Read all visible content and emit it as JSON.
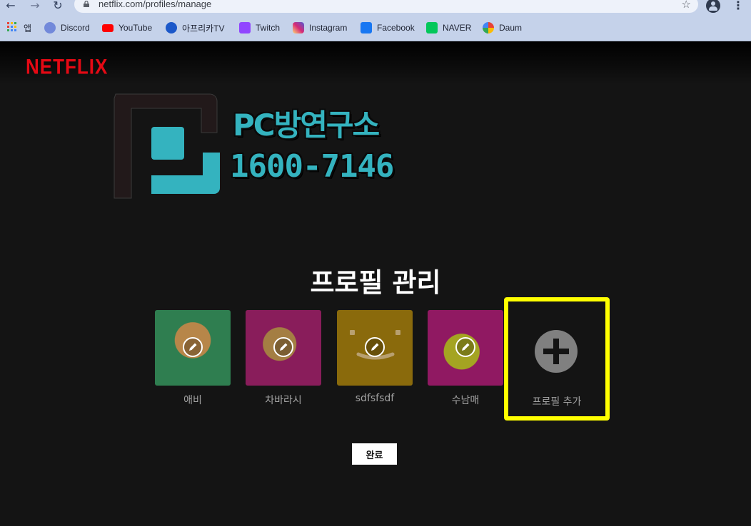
{
  "browser": {
    "url": "netflix.com/profiles/manage",
    "bookmarks": [
      {
        "label": "앱",
        "icon": "apps-grid-icon"
      },
      {
        "label": "Discord",
        "icon": "discord-icon"
      },
      {
        "label": "YouTube",
        "icon": "youtube-icon"
      },
      {
        "label": "아프리카TV",
        "icon": "afreecatv-icon"
      },
      {
        "label": "Twitch",
        "icon": "twitch-icon"
      },
      {
        "label": "Instagram",
        "icon": "instagram-icon"
      },
      {
        "label": "Facebook",
        "icon": "facebook-icon"
      },
      {
        "label": "NAVER",
        "icon": "naver-icon"
      },
      {
        "label": "Daum",
        "icon": "daum-icon"
      }
    ]
  },
  "brand": {
    "logo_text": "NETFLIX",
    "color": "#e50914"
  },
  "overlay_ad": {
    "title": "PC방연구소",
    "phone": "1600-7146",
    "color": "#34b3bf"
  },
  "page": {
    "title": "프로필 관리"
  },
  "profiles": [
    {
      "name": "애비",
      "bg": "#2e8a55",
      "edit_icon": "pencil-icon"
    },
    {
      "name": "차바라시",
      "bg": "#a0246e",
      "edit_icon": "pencil-icon"
    },
    {
      "name": "sdfsfsdf",
      "bg": "#8a6a0c",
      "edit_icon": "pencil-icon"
    },
    {
      "name": "수남매",
      "bg": "#b0207a",
      "edit_icon": "pencil-icon"
    }
  ],
  "add_profile": {
    "label": "프로필 추가",
    "highlight_color": "#ffff00"
  },
  "done_button": {
    "label": "완료"
  }
}
